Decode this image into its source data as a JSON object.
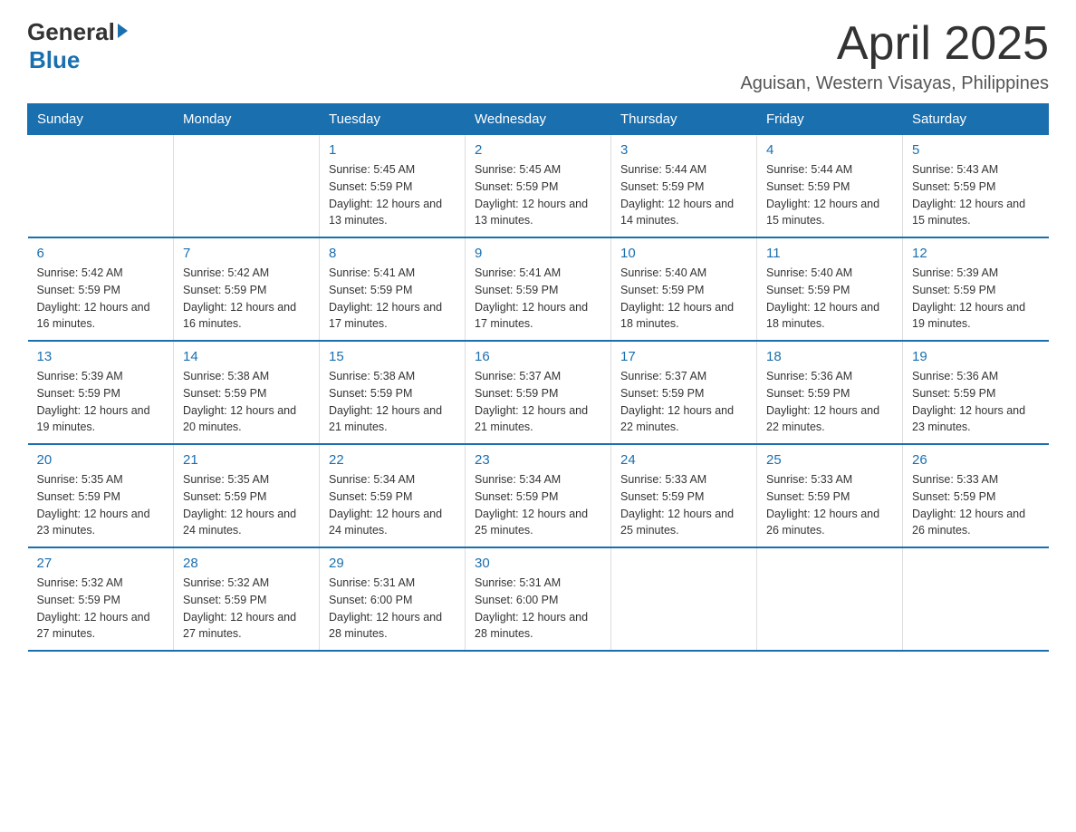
{
  "header": {
    "logo_general": "General",
    "logo_blue": "Blue",
    "month_title": "April 2025",
    "location": "Aguisan, Western Visayas, Philippines"
  },
  "weekdays": [
    "Sunday",
    "Monday",
    "Tuesday",
    "Wednesday",
    "Thursday",
    "Friday",
    "Saturday"
  ],
  "weeks": [
    [
      {
        "day": "",
        "sunrise": "",
        "sunset": "",
        "daylight": ""
      },
      {
        "day": "",
        "sunrise": "",
        "sunset": "",
        "daylight": ""
      },
      {
        "day": "1",
        "sunrise": "Sunrise: 5:45 AM",
        "sunset": "Sunset: 5:59 PM",
        "daylight": "Daylight: 12 hours and 13 minutes."
      },
      {
        "day": "2",
        "sunrise": "Sunrise: 5:45 AM",
        "sunset": "Sunset: 5:59 PM",
        "daylight": "Daylight: 12 hours and 13 minutes."
      },
      {
        "day": "3",
        "sunrise": "Sunrise: 5:44 AM",
        "sunset": "Sunset: 5:59 PM",
        "daylight": "Daylight: 12 hours and 14 minutes."
      },
      {
        "day": "4",
        "sunrise": "Sunrise: 5:44 AM",
        "sunset": "Sunset: 5:59 PM",
        "daylight": "Daylight: 12 hours and 15 minutes."
      },
      {
        "day": "5",
        "sunrise": "Sunrise: 5:43 AM",
        "sunset": "Sunset: 5:59 PM",
        "daylight": "Daylight: 12 hours and 15 minutes."
      }
    ],
    [
      {
        "day": "6",
        "sunrise": "Sunrise: 5:42 AM",
        "sunset": "Sunset: 5:59 PM",
        "daylight": "Daylight: 12 hours and 16 minutes."
      },
      {
        "day": "7",
        "sunrise": "Sunrise: 5:42 AM",
        "sunset": "Sunset: 5:59 PM",
        "daylight": "Daylight: 12 hours and 16 minutes."
      },
      {
        "day": "8",
        "sunrise": "Sunrise: 5:41 AM",
        "sunset": "Sunset: 5:59 PM",
        "daylight": "Daylight: 12 hours and 17 minutes."
      },
      {
        "day": "9",
        "sunrise": "Sunrise: 5:41 AM",
        "sunset": "Sunset: 5:59 PM",
        "daylight": "Daylight: 12 hours and 17 minutes."
      },
      {
        "day": "10",
        "sunrise": "Sunrise: 5:40 AM",
        "sunset": "Sunset: 5:59 PM",
        "daylight": "Daylight: 12 hours and 18 minutes."
      },
      {
        "day": "11",
        "sunrise": "Sunrise: 5:40 AM",
        "sunset": "Sunset: 5:59 PM",
        "daylight": "Daylight: 12 hours and 18 minutes."
      },
      {
        "day": "12",
        "sunrise": "Sunrise: 5:39 AM",
        "sunset": "Sunset: 5:59 PM",
        "daylight": "Daylight: 12 hours and 19 minutes."
      }
    ],
    [
      {
        "day": "13",
        "sunrise": "Sunrise: 5:39 AM",
        "sunset": "Sunset: 5:59 PM",
        "daylight": "Daylight: 12 hours and 19 minutes."
      },
      {
        "day": "14",
        "sunrise": "Sunrise: 5:38 AM",
        "sunset": "Sunset: 5:59 PM",
        "daylight": "Daylight: 12 hours and 20 minutes."
      },
      {
        "day": "15",
        "sunrise": "Sunrise: 5:38 AM",
        "sunset": "Sunset: 5:59 PM",
        "daylight": "Daylight: 12 hours and 21 minutes."
      },
      {
        "day": "16",
        "sunrise": "Sunrise: 5:37 AM",
        "sunset": "Sunset: 5:59 PM",
        "daylight": "Daylight: 12 hours and 21 minutes."
      },
      {
        "day": "17",
        "sunrise": "Sunrise: 5:37 AM",
        "sunset": "Sunset: 5:59 PM",
        "daylight": "Daylight: 12 hours and 22 minutes."
      },
      {
        "day": "18",
        "sunrise": "Sunrise: 5:36 AM",
        "sunset": "Sunset: 5:59 PM",
        "daylight": "Daylight: 12 hours and 22 minutes."
      },
      {
        "day": "19",
        "sunrise": "Sunrise: 5:36 AM",
        "sunset": "Sunset: 5:59 PM",
        "daylight": "Daylight: 12 hours and 23 minutes."
      }
    ],
    [
      {
        "day": "20",
        "sunrise": "Sunrise: 5:35 AM",
        "sunset": "Sunset: 5:59 PM",
        "daylight": "Daylight: 12 hours and 23 minutes."
      },
      {
        "day": "21",
        "sunrise": "Sunrise: 5:35 AM",
        "sunset": "Sunset: 5:59 PM",
        "daylight": "Daylight: 12 hours and 24 minutes."
      },
      {
        "day": "22",
        "sunrise": "Sunrise: 5:34 AM",
        "sunset": "Sunset: 5:59 PM",
        "daylight": "Daylight: 12 hours and 24 minutes."
      },
      {
        "day": "23",
        "sunrise": "Sunrise: 5:34 AM",
        "sunset": "Sunset: 5:59 PM",
        "daylight": "Daylight: 12 hours and 25 minutes."
      },
      {
        "day": "24",
        "sunrise": "Sunrise: 5:33 AM",
        "sunset": "Sunset: 5:59 PM",
        "daylight": "Daylight: 12 hours and 25 minutes."
      },
      {
        "day": "25",
        "sunrise": "Sunrise: 5:33 AM",
        "sunset": "Sunset: 5:59 PM",
        "daylight": "Daylight: 12 hours and 26 minutes."
      },
      {
        "day": "26",
        "sunrise": "Sunrise: 5:33 AM",
        "sunset": "Sunset: 5:59 PM",
        "daylight": "Daylight: 12 hours and 26 minutes."
      }
    ],
    [
      {
        "day": "27",
        "sunrise": "Sunrise: 5:32 AM",
        "sunset": "Sunset: 5:59 PM",
        "daylight": "Daylight: 12 hours and 27 minutes."
      },
      {
        "day": "28",
        "sunrise": "Sunrise: 5:32 AM",
        "sunset": "Sunset: 5:59 PM",
        "daylight": "Daylight: 12 hours and 27 minutes."
      },
      {
        "day": "29",
        "sunrise": "Sunrise: 5:31 AM",
        "sunset": "Sunset: 6:00 PM",
        "daylight": "Daylight: 12 hours and 28 minutes."
      },
      {
        "day": "30",
        "sunrise": "Sunrise: 5:31 AM",
        "sunset": "Sunset: 6:00 PM",
        "daylight": "Daylight: 12 hours and 28 minutes."
      },
      {
        "day": "",
        "sunrise": "",
        "sunset": "",
        "daylight": ""
      },
      {
        "day": "",
        "sunrise": "",
        "sunset": "",
        "daylight": ""
      },
      {
        "day": "",
        "sunrise": "",
        "sunset": "",
        "daylight": ""
      }
    ]
  ]
}
